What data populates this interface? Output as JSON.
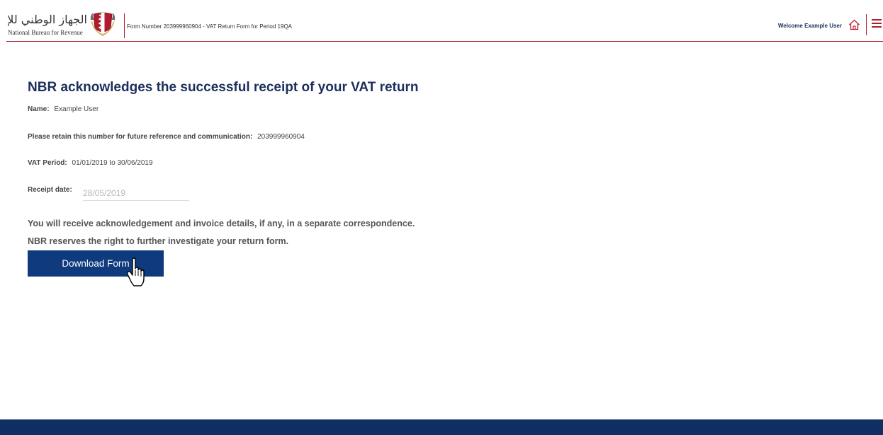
{
  "header": {
    "logo_arabic": "الجهاز الوطني للإيرادات",
    "logo_english": "National Bureau for Revenue",
    "form_title": "Form Number 203999960904 - VAT Return Form for Period 19QA",
    "welcome": "Welcome Example User",
    "home_icon": "home-icon",
    "menu_icon": "hamburger-menu-icon"
  },
  "main": {
    "title": "NBR acknowledges the successful receipt of your VAT return",
    "name": {
      "label": "Name:",
      "value": "Example User"
    },
    "reference": {
      "label": "Please retain this number for future reference and communication:",
      "value": "203999960904"
    },
    "vat_period": {
      "label": "VAT Period:",
      "value": "01/01/2019 to 30/06/2019"
    },
    "receipt_date": {
      "label": "Receipt date:",
      "value": "28/05/2019"
    },
    "notice_1": "You will receive acknowledgement and invoice details, if any, in a separate correspondence.",
    "notice_2": "NBR reserves the right to further investigate your return form.",
    "download_button": "Download Form"
  },
  "colors": {
    "brand_red": "#b01c2e",
    "brand_navy": "#1c2f5c",
    "button_blue": "#0f3a7d",
    "footer_navy": "#0f2f63"
  }
}
